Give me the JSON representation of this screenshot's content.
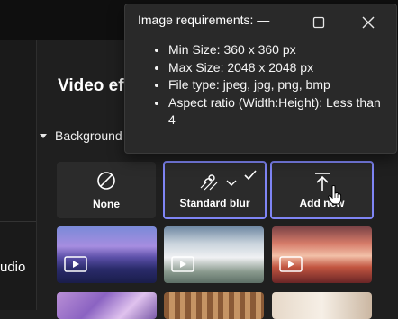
{
  "panel": {
    "title": "Video ef",
    "section_label": "Background",
    "left_label": "udio"
  },
  "tiles": [
    {
      "label": "None",
      "icon": "none-icon",
      "selected": false
    },
    {
      "label": "Standard blur",
      "icon": "blur-icon",
      "selected": true
    },
    {
      "label": "Add new",
      "icon": "upload-icon",
      "selected": true
    }
  ],
  "backgrounds": [
    {
      "name": "purple-lake-night",
      "icon": "video-icon"
    },
    {
      "name": "snowy-trees",
      "icon": "video-icon"
    },
    {
      "name": "red-snowy-mountains",
      "icon": "video-icon"
    },
    {
      "name": "pink-flowers"
    },
    {
      "name": "wooden-room"
    },
    {
      "name": "bright-room"
    }
  ],
  "popup": {
    "title": "Image requirements: —",
    "items": [
      "Min Size: 360 x 360 px",
      "Max Size: 2048 x 2048 px",
      "File type: jpeg, jpg, png, bmp",
      "Aspect ratio (Width:Height): Less than 4"
    ]
  },
  "colors": {
    "accent": "#7f85f5",
    "popup_bg": "#292929",
    "app_bg": "#1f1f1f"
  }
}
